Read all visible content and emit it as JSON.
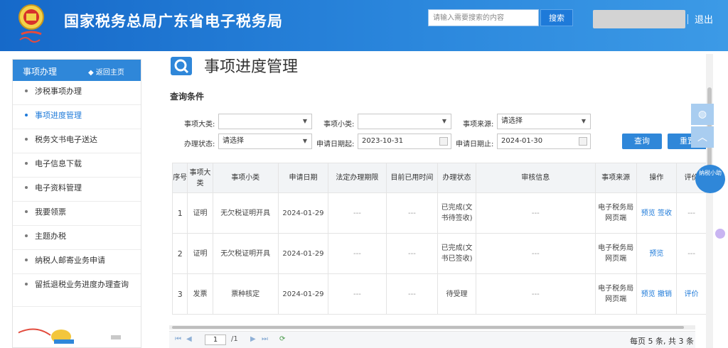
{
  "header": {
    "title": "国家税务总局广东省电子税务局",
    "search_placeholder": "请输入需要搜索的内容",
    "search_button": "搜索",
    "logout": "退出"
  },
  "sidebar": {
    "title": "事项办理",
    "back": "返回主页",
    "items": [
      {
        "label": "涉税事项办理"
      },
      {
        "label": "事项进度管理"
      },
      {
        "label": "税务文书电子送达"
      },
      {
        "label": "电子信息下载"
      },
      {
        "label": "电子资料管理"
      },
      {
        "label": "我要领票"
      },
      {
        "label": "主题办税"
      },
      {
        "label": "纳税人邮寄业务申请"
      },
      {
        "label": "留抵退税业务进度办理查询"
      }
    ]
  },
  "main": {
    "title": "事项进度管理",
    "section": "查询条件",
    "filters": {
      "category_label": "事项大类:",
      "category_value": "",
      "subcategory_label": "事项小类:",
      "subcategory_value": "",
      "source_label": "事项来源:",
      "source_value": "请选择",
      "status_label": "办理状态:",
      "status_value": "请选择",
      "date_from_label": "申请日期起:",
      "date_from_value": "2023-10-31",
      "date_to_label": "申请日期止:",
      "date_to_value": "2024-01-30"
    },
    "buttons": {
      "query": "查询",
      "reset": "重置"
    },
    "table": {
      "headers": [
        "序号",
        "事项大类",
        "事项小类",
        "申请日期",
        "法定办理期限",
        "目前已用时间",
        "办理状态",
        "审核信息",
        "事项来源",
        "操作",
        "评价"
      ],
      "rows": [
        {
          "no": "1",
          "category": "证明",
          "sub": "无欠税证明开具",
          "date": "2024-01-29",
          "limit": "---",
          "used": "---",
          "status": "已完成(文书待签收)",
          "audit": "---",
          "source": "电子税务局网页端",
          "ops": [
            "预览",
            "签收"
          ],
          "rating": "---"
        },
        {
          "no": "2",
          "category": "证明",
          "sub": "无欠税证明开具",
          "date": "2024-01-29",
          "limit": "---",
          "used": "---",
          "status": "已完成(文书已签收)",
          "audit": "---",
          "source": "电子税务局网页端",
          "ops": [
            "预览"
          ],
          "rating": "---"
        },
        {
          "no": "3",
          "category": "发票",
          "sub": "票种核定",
          "date": "2024-01-29",
          "limit": "---",
          "used": "---",
          "status": "待受理",
          "audit": "---",
          "source": "电子税务局网页端",
          "ops": [
            "预览",
            "撤销"
          ],
          "rating": "评价"
        }
      ]
    },
    "pager": {
      "page": "1",
      "total_pages": "/1",
      "summary": "每页 5 条, 共 3 条"
    }
  },
  "mascot_text": "纳税小助"
}
